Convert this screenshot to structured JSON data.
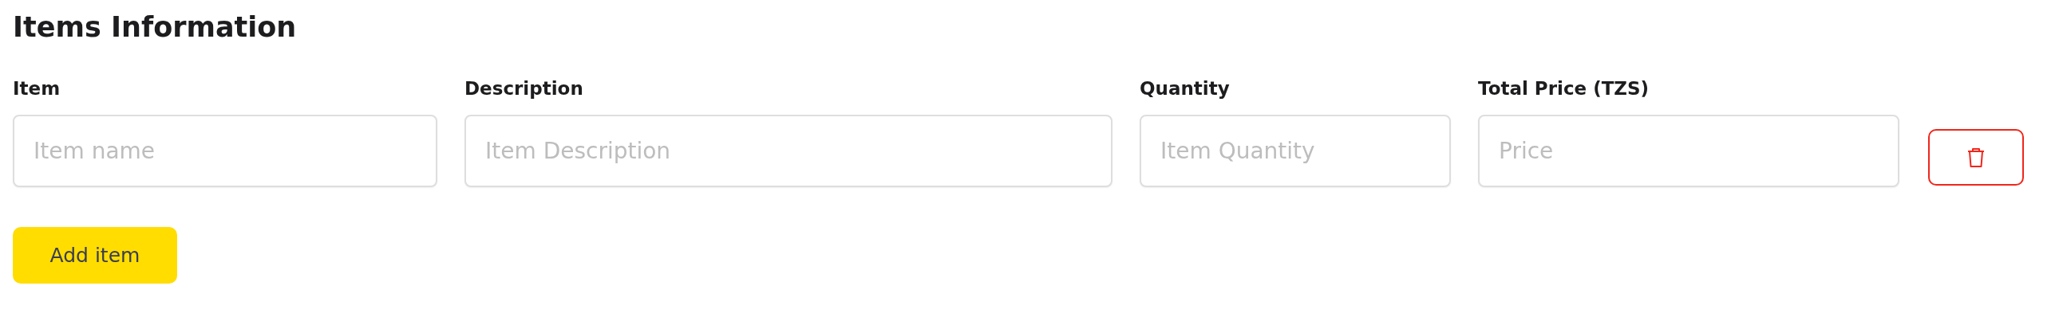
{
  "section": {
    "title": "Items Information"
  },
  "fields": [
    {
      "label": "Item",
      "placeholder": "Item name"
    },
    {
      "label": "Description",
      "placeholder": "Item Description"
    },
    {
      "label": "Quantity",
      "placeholder": "Item Quantity"
    },
    {
      "label": "Total Price (TZS)",
      "placeholder": "Price"
    }
  ],
  "add_button": {
    "label": "Add item"
  }
}
